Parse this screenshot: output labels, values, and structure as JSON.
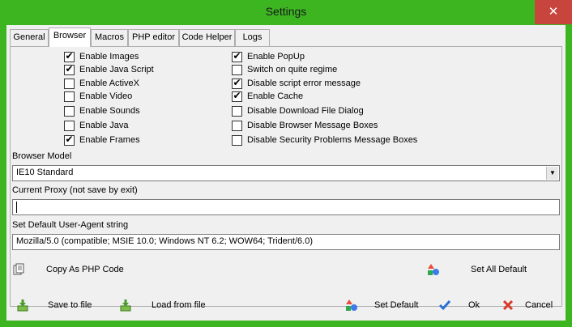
{
  "window": {
    "title": "Settings",
    "close_glyph": "✕"
  },
  "tabs": [
    {
      "label": "General"
    },
    {
      "label": "Browser"
    },
    {
      "label": "Macros"
    },
    {
      "label": "PHP editor"
    },
    {
      "label": "Code Helper"
    },
    {
      "label": "Logs"
    }
  ],
  "active_tab": "Browser",
  "checkboxes_left": [
    {
      "label": "Enable Images",
      "checked": true
    },
    {
      "label": "Enable Java Script",
      "checked": true
    },
    {
      "label": "Enable ActiveX",
      "checked": false
    },
    {
      "label": "Enable Video",
      "checked": false
    },
    {
      "label": "Enable Sounds",
      "checked": false
    },
    {
      "label": "Enable Java",
      "checked": false
    },
    {
      "label": "Enable Frames",
      "checked": true
    }
  ],
  "checkboxes_right": [
    {
      "label": "Enable PopUp",
      "checked": true
    },
    {
      "label": "Switch on quite regime",
      "checked": false
    },
    {
      "label": "Disable script error message",
      "checked": true
    },
    {
      "label": "Enable Cache",
      "checked": true
    },
    {
      "label": "Disable Download File Dialog",
      "checked": false
    },
    {
      "label": "Disable Browser Message Boxes",
      "checked": false
    },
    {
      "label": "Disable Security Problems Message Boxes",
      "checked": false
    }
  ],
  "browser_model": {
    "label": "Browser Model",
    "value": "IE10 Standard"
  },
  "proxy": {
    "label": "Current Proxy (not save by exit)",
    "value": ""
  },
  "user_agent": {
    "label": "Set Default User-Agent string",
    "value": "Mozilla/5.0 (compatible; MSIE 10.0; Windows NT 6.2; WOW64; Trident/6.0)"
  },
  "buttons": {
    "copy_php": "Copy As PHP Code",
    "set_all_default": "Set All Default",
    "save_to_file": "Save to file",
    "load_from_file": "Load from file",
    "set_default": "Set Default",
    "ok": "Ok",
    "cancel": "Cancel"
  },
  "colors": {
    "title_bar": "#3cb521",
    "close_button": "#c7453c",
    "panel": "#f0f0f0",
    "ok_check": "#2a6fd6",
    "cancel_x": "#d63a2a"
  }
}
